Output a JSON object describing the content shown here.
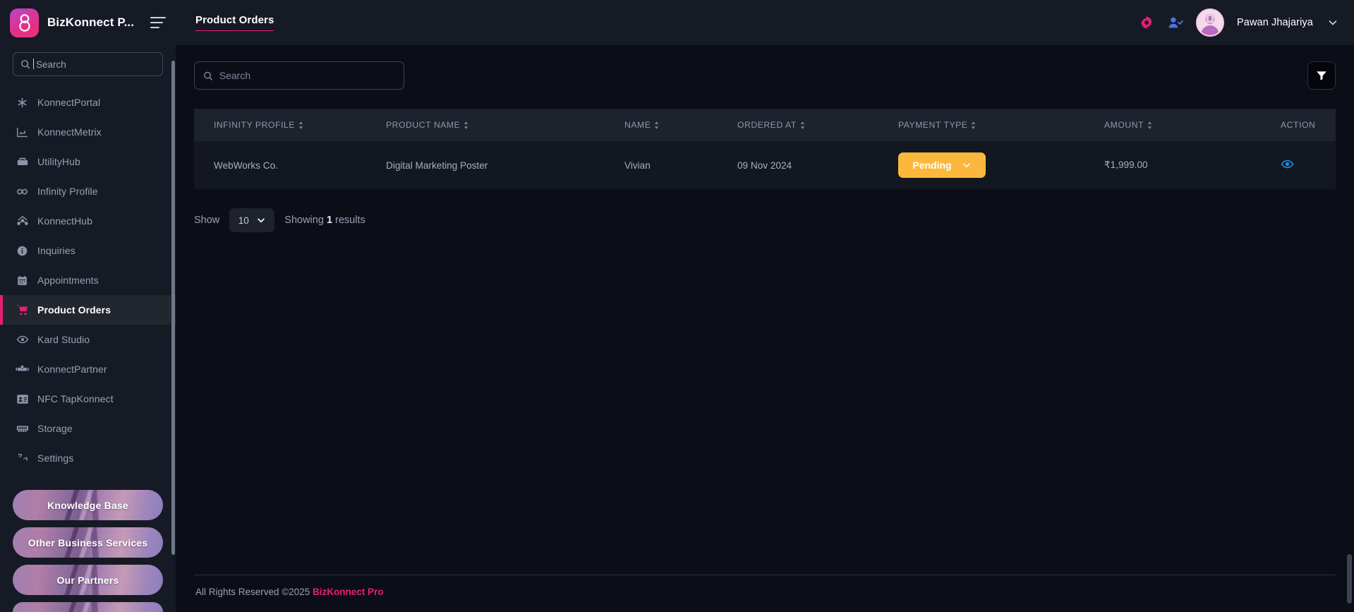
{
  "brand": {
    "name": "BizKonnect P...",
    "logo_icon": "infinity-logo-icon",
    "menu_icon": "hamburger-menu-icon"
  },
  "sidebar": {
    "search": {
      "placeholder": "Search",
      "value": "",
      "icon": "search-icon"
    },
    "items": [
      {
        "label": "KonnectPortal",
        "icon": "asterisk-icon",
        "active": false
      },
      {
        "label": "KonnectMetrix",
        "icon": "chart-bar-icon",
        "active": false
      },
      {
        "label": "UtilityHub",
        "icon": "toolbox-icon",
        "active": false
      },
      {
        "label": "Infinity Profile",
        "icon": "infinity-icon",
        "active": false
      },
      {
        "label": "KonnectHub",
        "icon": "network-hub-icon",
        "active": false
      },
      {
        "label": "Inquiries",
        "icon": "info-circle-icon",
        "active": false
      },
      {
        "label": "Appointments",
        "icon": "calendar-icon",
        "active": false
      },
      {
        "label": "Product Orders",
        "icon": "shopping-cart-icon",
        "active": true
      },
      {
        "label": "Kard Studio",
        "icon": "eye-icon",
        "active": false
      },
      {
        "label": "KonnectPartner",
        "icon": "handshake-icon",
        "active": false
      },
      {
        "label": "NFC TapKonnect",
        "icon": "id-card-icon",
        "active": false
      },
      {
        "label": "Storage",
        "icon": "memory-chip-icon",
        "active": false
      },
      {
        "label": "Settings",
        "icon": "gears-icon",
        "active": false
      }
    ],
    "promos": [
      {
        "label": "Knowledge Base"
      },
      {
        "label": "Other Business Services"
      },
      {
        "label": "Our Partners"
      }
    ]
  },
  "topbar": {
    "breadcrumb": "Product Orders",
    "settings_icon": "gear-icon",
    "user_check_icon": "user-check-icon",
    "avatar_icon": "user-avatar",
    "user_name": "Pawan Jhajariya",
    "chevron_icon": "chevron-down-icon"
  },
  "toolbar": {
    "search": {
      "placeholder": "Search",
      "value": "",
      "icon": "search-icon"
    },
    "filter_icon": "funnel-filter-icon"
  },
  "table": {
    "columns": [
      {
        "label": "INFINITY PROFILE",
        "sortable": true
      },
      {
        "label": "PRODUCT NAME",
        "sortable": true
      },
      {
        "label": "NAME",
        "sortable": true
      },
      {
        "label": "ORDERED AT",
        "sortable": true
      },
      {
        "label": "PAYMENT TYPE",
        "sortable": true
      },
      {
        "label": "AMOUNT",
        "sortable": true
      },
      {
        "label": "ACTION",
        "sortable": false
      }
    ],
    "rows": [
      {
        "infinity_profile": "WebWorks Co.",
        "product_name": "Digital Marketing Poster",
        "name": "Vivian",
        "ordered_at": "09 Nov 2024",
        "payment_type": "Pending",
        "amount": "₹1,999.00",
        "action_icon": "eye-icon"
      }
    ]
  },
  "pager": {
    "show_label": "Show",
    "page_size": "10",
    "showing_prefix": "Showing ",
    "showing_count": "1",
    "showing_suffix": " results"
  },
  "footer": {
    "text": "All Rights Reserved ©2025 ",
    "brand": "BizKonnect Pro"
  },
  "colors": {
    "accent_pink": "#e91e76",
    "status_pending": "#fcb83c",
    "action_blue": "#1e8fe8",
    "sidebar_bg": "#161a24",
    "page_bg": "#0b0e17",
    "row_bg": "#13171f",
    "header_row_bg": "#1d222d"
  }
}
